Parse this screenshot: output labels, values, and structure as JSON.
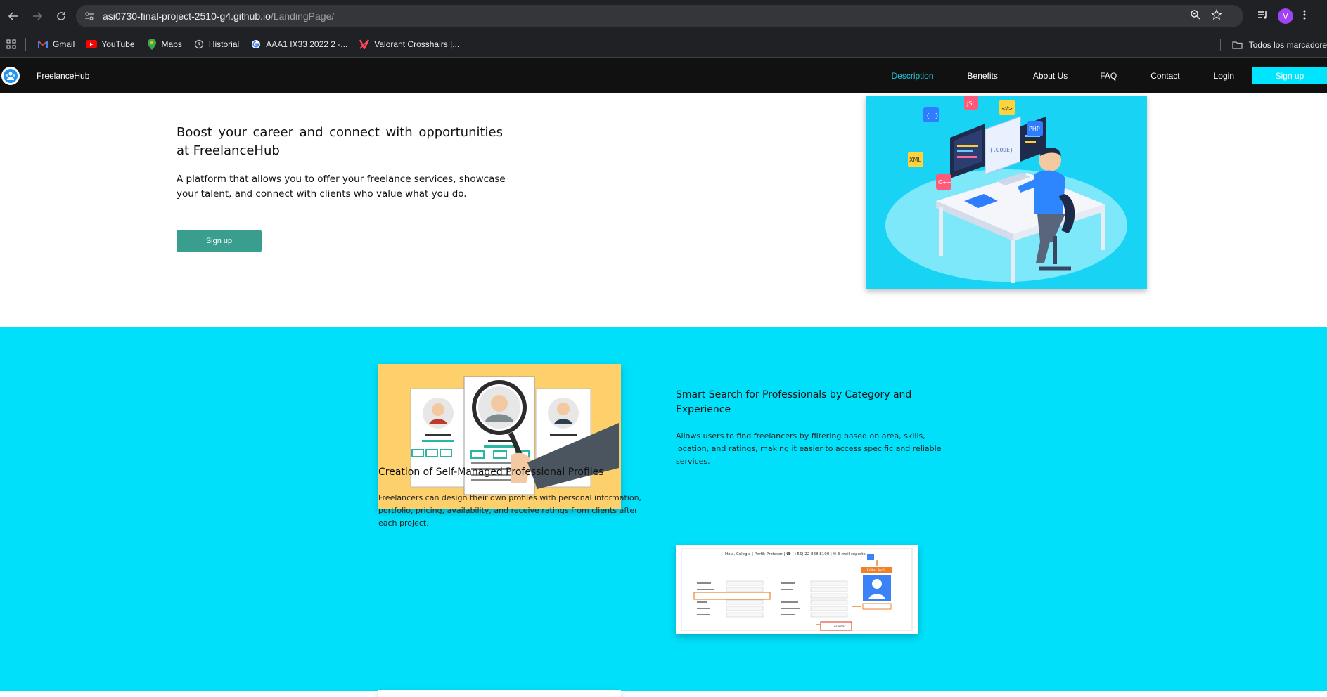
{
  "browser": {
    "url_host": "asi0730-final-project-2510-g4.github.io",
    "url_path": "/LandingPage/",
    "profile_initial": "V",
    "bookmarks": [
      {
        "label": "Gmail",
        "icon": "gmail-icon"
      },
      {
        "label": "YouTube",
        "icon": "youtube-icon"
      },
      {
        "label": "Maps",
        "icon": "maps-icon"
      },
      {
        "label": "Historial",
        "icon": "history-icon"
      },
      {
        "label": "AAA1 IX33 2022 2 -...",
        "icon": "google-icon"
      },
      {
        "label": "Valorant Crosshairs |...",
        "icon": "valorant-icon"
      }
    ],
    "all_bookmarks": "Todos los marcadore"
  },
  "navbar": {
    "brand": "FreelanceHub",
    "links": [
      "Description",
      "Benefits",
      "About Us",
      "FAQ",
      "Contact",
      "Login"
    ],
    "active": "Description",
    "signup": "Sign up"
  },
  "hero": {
    "title": "Boost your career and connect with opportunities at FreelanceHub",
    "text": "A platform that allows you to offer your freelance services, showcase your talent, and connect with clients who value what you do.",
    "button": "Sign up",
    "image_tags": [
      "{...}",
      "JS",
      "</>",
      "PHP",
      "XML",
      "C++",
      "{.CODE}"
    ]
  },
  "features": [
    {
      "title": "Smart Search for Professionals by Category and Experience",
      "text": "Allows users to find freelancers by filtering based on area, skills, location, and ratings, making it easier to access specific and reliable services."
    },
    {
      "title": "Creation of Self-Managed Professional Profiles",
      "text": "Freelancers can design their own profiles with personal information, portfolio, pricing, availability, and receive ratings from clients after each project."
    }
  ],
  "profile_screenshot": {
    "header": "Hola, Colegio | Perfil: Profesor | ☎ (+56) 22 888 8100 | ✉ E-mail soporte",
    "edit_label": "Editar Perfil",
    "save_label": "Guardar"
  },
  "colors": {
    "nav_bg": "#111111",
    "accent_cyan": "#00e5ff",
    "features_bg": "#00e0fb",
    "hero_button": "#3a9e8e",
    "active_link": "#26c6da"
  }
}
